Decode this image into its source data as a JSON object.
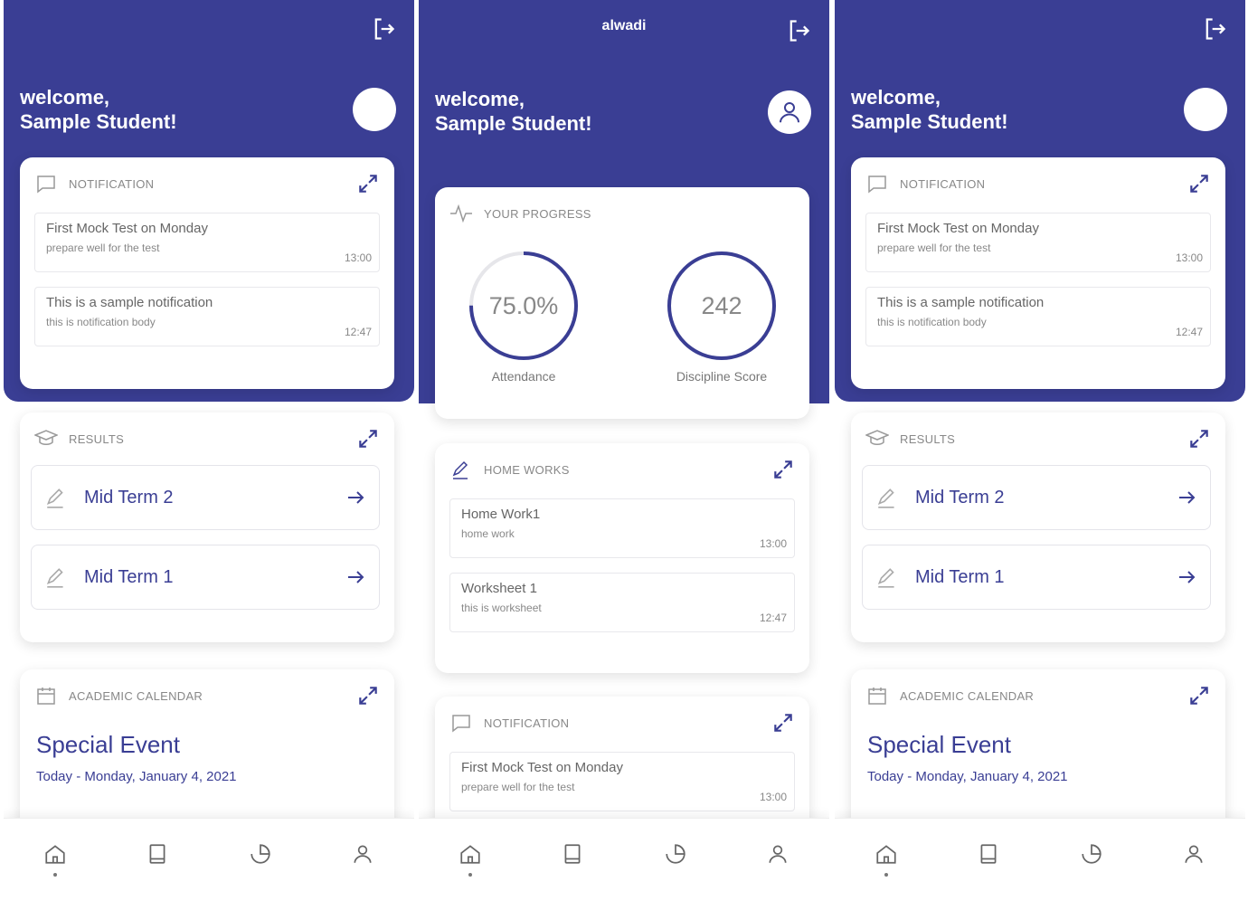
{
  "brand": {
    "primary": "#3a3e94",
    "background": "#ffffff"
  },
  "screens": [
    {
      "app_title": "",
      "welcome_line1": "welcome,",
      "welcome_line2": "Sample Student!",
      "notification": {
        "title": "NOTIFICATION",
        "items": [
          {
            "title": "First Mock Test on Monday",
            "body": "prepare well for the test",
            "time": "13:00"
          },
          {
            "title": "This is a sample notification",
            "body": "this is notification body",
            "time": "12:47"
          }
        ]
      },
      "results": {
        "title": "RESULTS",
        "items": [
          {
            "label": "Mid Term 2"
          },
          {
            "label": "Mid Term 1"
          }
        ]
      },
      "calendar": {
        "title": "ACADEMIC CALENDAR",
        "event": "Special Event",
        "date": "Today - Monday, January 4, 2021"
      }
    },
    {
      "app_title": "alwadi",
      "welcome_line1": "welcome,",
      "welcome_line2": "Sample Student!",
      "progress": {
        "title": "YOUR PROGRESS",
        "attendance_value": "75.0%",
        "attendance_fraction": 0.75,
        "attendance_label": "Attendance",
        "discipline_value": "242",
        "discipline_fraction": 1.0,
        "discipline_label": "Discipline Score"
      },
      "homeworks": {
        "title": "HOME WORKS",
        "items": [
          {
            "title": "Home Work1",
            "body": "home work",
            "time": "13:00"
          },
          {
            "title": "Worksheet 1",
            "body": "this is worksheet",
            "time": "12:47"
          }
        ]
      },
      "notification": {
        "title": "NOTIFICATION",
        "items": [
          {
            "title": "First Mock Test on Monday",
            "body": "prepare well for the test",
            "time": "13:00"
          }
        ]
      }
    },
    {
      "app_title": "",
      "welcome_line1": "welcome,",
      "welcome_line2": "Sample Student!",
      "notification": {
        "title": "NOTIFICATION",
        "items": [
          {
            "title": "First Mock Test on Monday",
            "body": "prepare well for the test",
            "time": "13:00"
          },
          {
            "title": "This is a sample notification",
            "body": "this is notification body",
            "time": "12:47"
          }
        ]
      },
      "results": {
        "title": "RESULTS",
        "items": [
          {
            "label": "Mid Term 2"
          },
          {
            "label": "Mid Term 1"
          }
        ]
      },
      "calendar": {
        "title": "ACADEMIC CALENDAR",
        "event": "Special Event",
        "date": "Today - Monday, January 4, 2021"
      }
    }
  ],
  "icons": {
    "logout": "logout-icon",
    "expand": "expand-icon",
    "chat": "chat-bubble-icon",
    "graduation": "graduation-cap-icon",
    "pencil": "pencil-icon",
    "arrow": "arrow-right-icon",
    "calendar": "calendar-icon",
    "pulse": "pulse-icon",
    "home": "home-icon",
    "book": "book-icon",
    "pie": "pie-chart-icon",
    "user": "user-icon"
  }
}
